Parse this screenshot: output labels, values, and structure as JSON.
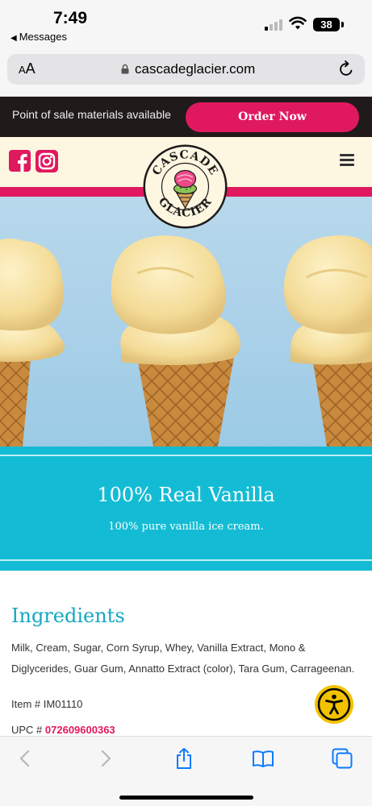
{
  "status_bar": {
    "time": "7:49",
    "back_label": "Messages",
    "battery": "38"
  },
  "browser": {
    "aa_label_small": "A",
    "aa_label_large": "A",
    "url": "cascadeglacier.com"
  },
  "promo": {
    "text": "Point of sale materials available",
    "button_label": "Order Now"
  },
  "header": {
    "logo_text_top": "CASCADE",
    "logo_text_bottom": "GLACIER"
  },
  "hero_banner": {
    "title": "100% Real Vanilla",
    "subtitle": "100% pure vanilla ice cream."
  },
  "ingredients": {
    "heading": "Ingredients",
    "text": "Milk, Cream, Sugar, Corn Syrup, Whey, Vanilla Extract, Mono & Diglycerides, Guar Gum, Annatto Extract (color), Tara Gum, Carrageenan.",
    "item_label": "Item # ",
    "item_number": "IM01110",
    "upc_label": "UPC # ",
    "upc_number": "072609600363"
  },
  "colors": {
    "brand_pink": "#e0195f",
    "teal": "#13bcd4",
    "cream": "#fdf6e1",
    "dark_bar": "#201a1b",
    "accessibility_yellow": "#f2c200"
  },
  "icons": {
    "facebook": "facebook-icon",
    "instagram": "instagram-icon",
    "menu": "hamburger-menu-icon",
    "lock": "lock-icon",
    "reload": "reload-icon",
    "accessibility": "accessibility-icon",
    "back": "chevron-left-icon",
    "forward": "chevron-right-icon",
    "share": "share-icon",
    "bookmarks": "book-icon",
    "tabs": "tabs-icon"
  }
}
